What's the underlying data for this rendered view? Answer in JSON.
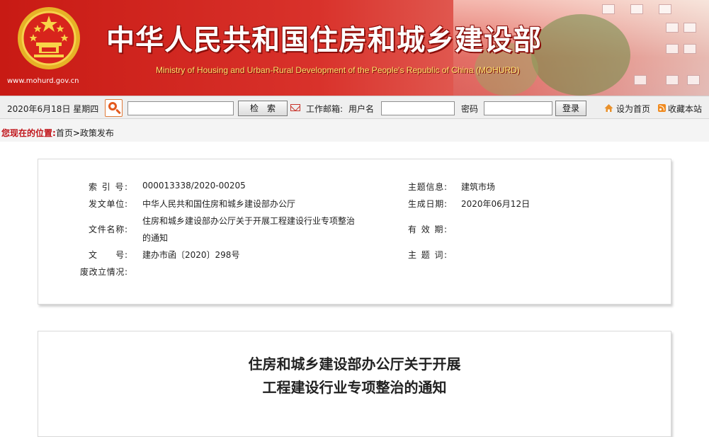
{
  "header": {
    "site_url": "www.mohurd.gov.cn",
    "title_cn": "中华人民共和国住房和城乡建设部",
    "title_en": "Ministry of Housing and Urban-Rural Development of the People's Republic of China (MOHURD)",
    "emblem_icon": "national-emblem-icon",
    "colors": {
      "banner_red": "#c81a14",
      "title_en_yellow": "#ffe36b"
    }
  },
  "toolbar": {
    "date": "2020年6月18日 星期四",
    "search_icon": "search-icon",
    "search_value": "",
    "search_button": "检　索",
    "mail_icon": "mail-icon",
    "work_mail_label": "工作邮箱:",
    "username_label": "用户名",
    "username_value": "",
    "password_label": "密码",
    "password_value": "",
    "login_button": "登录",
    "home_icon": "home-icon",
    "set_home": "设为首页",
    "rss_icon": "rss-icon",
    "bookmark": "收藏本站"
  },
  "breadcrumb": {
    "location_label": "您现在的位置:",
    "home": "首页",
    "separator": ">",
    "current": "政策发布"
  },
  "info": {
    "index_label": "索 引 号:",
    "index_value": "000013338/2020-00205",
    "topic_label": "主题信息:",
    "topic_value": "建筑市场",
    "issuer_label": "发文单位:",
    "issuer_value": "中华人民共和国住房和城乡建设部办公厅",
    "date_label": "生成日期:",
    "date_value": "2020年06月12日",
    "docname_label": "文件名称:",
    "docname_line1": "住房和城乡建设部办公厅关于开展工程建设行业专项整治",
    "docname_line2": "的通知",
    "valid_label": "有 效 期:",
    "valid_value": "",
    "docno_label": "文　　号:",
    "docno_value": "建办市函〔2020〕298号",
    "keywords_label": "主 题 词:",
    "keywords_value": "",
    "status_label": "废改立情况:",
    "status_value": ""
  },
  "article": {
    "title_line1": "住房和城乡建设部办公厅关于开展",
    "title_line2": "工程建设行业专项整治的通知"
  }
}
